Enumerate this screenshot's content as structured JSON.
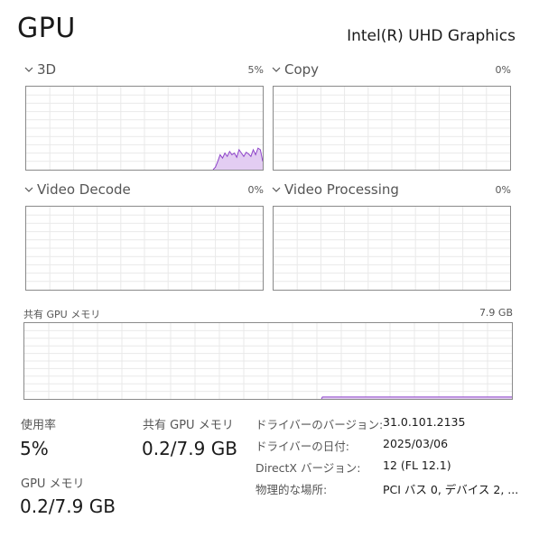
{
  "header": {
    "title": "GPU",
    "adapter_name": "Intel(R) UHD Graphics"
  },
  "engines": [
    {
      "label": "3D",
      "percent": "5%",
      "samples": [
        0,
        0,
        0,
        0,
        0,
        0,
        0,
        0,
        0,
        0,
        0,
        0,
        0,
        0,
        0,
        0,
        0,
        0,
        0,
        0,
        0,
        0,
        0,
        0,
        0,
        0,
        0,
        0,
        0,
        0,
        0,
        0,
        0,
        0,
        0,
        0,
        0,
        0,
        0,
        0,
        0,
        0,
        0,
        0,
        0,
        0,
        0,
        0,
        0,
        0,
        0,
        0,
        0,
        0,
        0,
        0,
        0,
        0,
        0,
        0,
        0,
        0,
        0,
        0,
        0,
        0,
        0,
        0,
        0,
        0,
        0,
        0,
        0,
        0,
        0,
        0,
        0,
        0,
        0,
        0,
        3,
        10,
        18,
        14,
        20,
        16,
        22,
        18,
        20,
        15,
        24,
        20,
        16,
        21,
        19,
        16,
        24,
        18,
        26,
        24,
        10
      ]
    },
    {
      "label": "Copy",
      "percent": "0%"
    },
    {
      "label": "Video Decode",
      "percent": "0%"
    },
    {
      "label": "Video Processing",
      "percent": "0%"
    }
  ],
  "shared_memory": {
    "label": "共有 GPU メモリ",
    "max": "7.9 GB",
    "samples": [
      0,
      0,
      0,
      0,
      0,
      0,
      0,
      0,
      0,
      0,
      0,
      0,
      0,
      0,
      0,
      0,
      0,
      0,
      0,
      0,
      0,
      0,
      0,
      0,
      0,
      0,
      0,
      0,
      0,
      0,
      0,
      0,
      0,
      0,
      0,
      0,
      0,
      0,
      0,
      0,
      0,
      0,
      0,
      0,
      0,
      0,
      0,
      0,
      0,
      0,
      0,
      0,
      0,
      0,
      0,
      0,
      0,
      0,
      0,
      0,
      0,
      0,
      0,
      0,
      0,
      0,
      0,
      0,
      0,
      0,
      0,
      0,
      0,
      0,
      0,
      0,
      0,
      0,
      0,
      0,
      0,
      0,
      0,
      0,
      0,
      0,
      0,
      0,
      0,
      0,
      0,
      0,
      0,
      0,
      0,
      0,
      0,
      0,
      0,
      0,
      0,
      0,
      0,
      0,
      0,
      0,
      0,
      0,
      0,
      0,
      0,
      0,
      0,
      0,
      0,
      0,
      0,
      0,
      0,
      0,
      0,
      0,
      0,
      0,
      0,
      0,
      0,
      0,
      0,
      0,
      0,
      0,
      0,
      0,
      0,
      0,
      0,
      0,
      0,
      0,
      0,
      0,
      0,
      0,
      0,
      0,
      0,
      0,
      0,
      0,
      0,
      0,
      0,
      0,
      0,
      0,
      0,
      0,
      0,
      0,
      0,
      0,
      0,
      0,
      0,
      0,
      0,
      0,
      0,
      0,
      0,
      0,
      0,
      0,
      0,
      0,
      0,
      0,
      0,
      0,
      0,
      0,
      0,
      0,
      0,
      0,
      0,
      0,
      0,
      0,
      0,
      0,
      0,
      0,
      0,
      0,
      0,
      0,
      0,
      0,
      0,
      0,
      0,
      0,
      0,
      0,
      0,
      0,
      0,
      0,
      0,
      0,
      0,
      0,
      0,
      0,
      0,
      0,
      0,
      0,
      0,
      0,
      0,
      0,
      0,
      0,
      0,
      0,
      0,
      0,
      0,
      0,
      0,
      0,
      0,
      0,
      0,
      0,
      0,
      0,
      0,
      0,
      0,
      0,
      0,
      0,
      0,
      0,
      0,
      0,
      0,
      0,
      0,
      0,
      0,
      0,
      0,
      0,
      0,
      0,
      0,
      0,
      0,
      0,
      0,
      0,
      0,
      0,
      0,
      0,
      0,
      0,
      0,
      0,
      0,
      0,
      0,
      0,
      0,
      0,
      0,
      0,
      0,
      0,
      0,
      0,
      0,
      0,
      0,
      0,
      0,
      0,
      0,
      0,
      0,
      0,
      0,
      0,
      0,
      0,
      0,
      0,
      0,
      0,
      0,
      0,
      0,
      0,
      0,
      0,
      0,
      0,
      0,
      0,
      0,
      0,
      0,
      0,
      0,
      0,
      0,
      0,
      0,
      0,
      0,
      0,
      0,
      0,
      0,
      0,
      0,
      0,
      0,
      0,
      0,
      0,
      0,
      0,
      2.5,
      2.5,
      2.5,
      2.5,
      2.5,
      2.5,
      2.5,
      2.5,
      2.5,
      2.5,
      2.5,
      2.5,
      2.5,
      2.5,
      2.5,
      2.5,
      2.5,
      2.5,
      2.5,
      2.5,
      2.5,
      2.5,
      2.5,
      2.5,
      2.5,
      2.5,
      2.5,
      2.5,
      2.5,
      2.5,
      2.5,
      2.5,
      2.5,
      2.5,
      2.5,
      2.5,
      2.5,
      2.5,
      2.5,
      2.5,
      2.5,
      2.5,
      2.5,
      2.5,
      2.5,
      2.5,
      2.5,
      2.5,
      2.5,
      2.5,
      2.5,
      2.5,
      2.5,
      2.5,
      2.5,
      2.5,
      2.5,
      2.5,
      2.5,
      2.5,
      2.5,
      2.5,
      2.5,
      2.5,
      2.5,
      2.5,
      2.5,
      2.5,
      2.5,
      2.5,
      2.5,
      2.5,
      2.5,
      2.5,
      2.5,
      2.5,
      2.5,
      2.5,
      2.5,
      2.5,
      2.5,
      2.5,
      2.5,
      2.5,
      2.5,
      2.5,
      2.5,
      2.5,
      2.5,
      2.5,
      2.5,
      2.5,
      2.5,
      2.5,
      2.5,
      2.5,
      2.5,
      2.5,
      2.5,
      2.5,
      2.5,
      2.5,
      2.5,
      2.5,
      2.5,
      2.5,
      2.5,
      2.5,
      2.5,
      2.5,
      2.5,
      2.5,
      2.5,
      2.5,
      2.5,
      2.5,
      2.5,
      2.5,
      2.5,
      2.5,
      2.5,
      2.5,
      2.5,
      2.5,
      2.5,
      2.5,
      2.5,
      2.5,
      2.5,
      2.5,
      2.5,
      2.5,
      2.5,
      2.5,
      2.5,
      2.5,
      2.5,
      2.5,
      2.5,
      2.5,
      2.5,
      2.5,
      2.5,
      2.5,
      2.5,
      2.5,
      2.5,
      2.5,
      2.5,
      2.5,
      2.5,
      2.5,
      2.5,
      2.5,
      2.5,
      2.5,
      2.5,
      2.5,
      2.5,
      2.5,
      2.5,
      2.5,
      2.5,
      2.5,
      2.5,
      2.5,
      2.5,
      2.5,
      2.5,
      2.5,
      2.5,
      2.5,
      2.5,
      2.5,
      2.5,
      2.5,
      2.5,
      2.5,
      2.5,
      2.5,
      2.5,
      2.5,
      2.5,
      2.5,
      2.5,
      2.5,
      2.5,
      2.5,
      2.5,
      2.5,
      2.5,
      2.5,
      2.5,
      2.5,
      2.5,
      2.5,
      2.5,
      2.5,
      2.5,
      2.5,
      2.5,
      2.5,
      2.5,
      2.5,
      2.5,
      2.5,
      2.5,
      2.5,
      2.5,
      2.5,
      2.5,
      2.5,
      2.5,
      2.5,
      2.5,
      2.5
    ]
  },
  "stats": {
    "utilization_label": "使用率",
    "utilization_value": "5%",
    "shared_mem_label": "共有 GPU メモリ",
    "shared_mem_value": "0.2/7.9 GB",
    "gpu_mem_label": "GPU メモリ",
    "gpu_mem_value": "0.2/7.9 GB"
  },
  "info": [
    {
      "key": "ドライバーのバージョン:",
      "value": "31.0.101.2135"
    },
    {
      "key": "ドライバーの日付:",
      "value": "2025/03/06"
    },
    {
      "key": "DirectX バージョン:",
      "value": "12 (FL 12.1)"
    },
    {
      "key": "物理的な場所:",
      "value": "PCI バス 0, デバイス 2, ..."
    }
  ],
  "colors": {
    "accent": "#8e44c9",
    "fill": "#e3cdf2",
    "grid": "#e9e9e9",
    "border": "#8a8a8a"
  }
}
